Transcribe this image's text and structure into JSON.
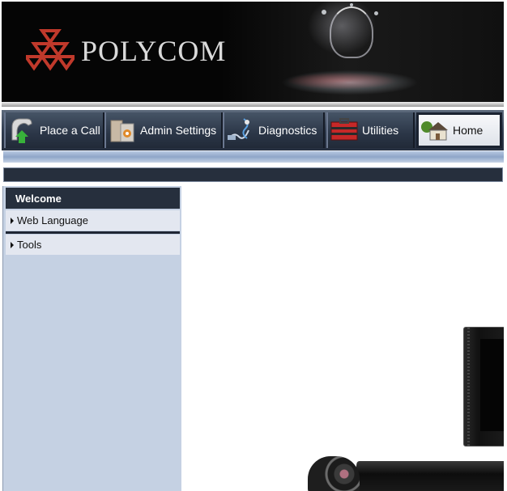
{
  "brand": {
    "name": "POLYCOM",
    "accent": "#c0392b"
  },
  "nav": {
    "items": [
      {
        "label": "Place a Call",
        "icon": "phone-icon"
      },
      {
        "label": "Admin Settings",
        "icon": "admin-settings-icon"
      },
      {
        "label": "Diagnostics",
        "icon": "diagnostics-icon"
      },
      {
        "label": "Utilities",
        "icon": "toolbox-icon"
      },
      {
        "label": "Home",
        "icon": "home-icon",
        "active": true
      }
    ]
  },
  "sidebar": {
    "header": "Welcome",
    "items": [
      {
        "label": "Web Language"
      },
      {
        "label": "Tools"
      }
    ]
  },
  "colors": {
    "navbar": "#2e3a4d",
    "sidebar": "#c5d1e3",
    "sidebar_header": "#262f3d"
  }
}
